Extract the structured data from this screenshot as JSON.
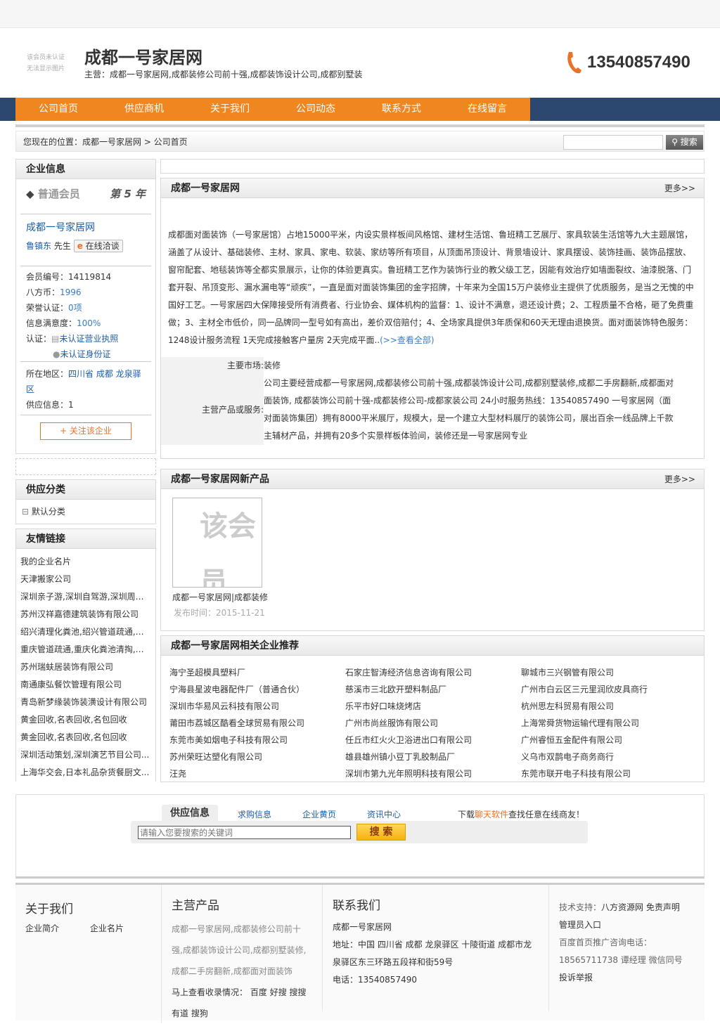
{
  "header": {
    "logo_placeholder": [
      "该会员未认证",
      "无法显示图片"
    ],
    "title": "成都一号家居网",
    "subtitle": "主营：成都一号家居网,成都装修公司前十强,成都装饰设计公司,成都别墅装",
    "phone": "13540857490"
  },
  "nav": [
    "公司首页",
    "供应商机",
    "关于我们",
    "公司动态",
    "联系方式",
    "在线留言"
  ],
  "breadcrumb": "您现在的位置：成都一号家居网 > 公司首页",
  "search_button": "搜索",
  "sidebar": {
    "info_title": "企业信息",
    "member_level": "普通会员",
    "member_years": "第 5 年",
    "company": "成都一号家居网",
    "contact_name": "鲁镇东",
    "contact_title": "先生",
    "chat": "在线洽谈",
    "member_id_label": "会员编号：",
    "member_id": "14119814",
    "coin_label": "八方币：",
    "coin": "1996",
    "honor_label": "荣誉认证：",
    "honor": "0项",
    "satisfaction_label": "信息满意度：",
    "satisfaction": "100%",
    "cert_label": "认证：",
    "cert_license": "未认证营业执照",
    "cert_id": "未认证身份证",
    "region_label": "所在地区：",
    "region": "四川省 成都 龙泉驿区",
    "supply_label": "供应信息：",
    "supply": "1",
    "follow": "+ 关注该企业",
    "category_title": "供应分类",
    "category": "默认分类",
    "links_title": "友情链接",
    "links": [
      "我的企业名片",
      "天津搬家公司",
      "深圳亲子游,深圳自驾游,深圳周边...",
      "苏州汉祥嘉德建筑装饰有限公司",
      "绍兴清理化粪池,绍兴管道疏通,绍...",
      "重庆管道疏通,重庆化粪池清掏,重...",
      "苏州瑞蚨居装饰有限公司",
      "南通康弘餐饮管理有限公司",
      "青岛新梦缘装饰装潢设计有限公司",
      "黄金回收,名表回收,名包回收",
      "黄金回收,名表回收,名包回收",
      "深圳活动策划,深圳演艺节目公司...",
      "上海华交会,日本礼品杂货餐厨文..."
    ]
  },
  "intro": {
    "title": "成都一号家居网",
    "more": "更多>>",
    "text": "成都面对面装饰（一号家居馆）占地15000平米，内设实景样板间风格馆、建材生活馆、鲁班精工艺展厅、家具软装生活馆等九大主题展馆，涵盖了从设计、基础装修、主材、家具、家电、软装、家纺等所有项目，从顶面吊顶设计、背景墙设计、家具摆设、装饰挂画、装饰品摆放、窗帘配套、地毯装饰等全都实景展示，让你的体验更真实。鲁班精工艺作为装饰行业的教父级工艺，因能有效治疗如墙面裂纹、油漆脱落、门套开裂、吊顶变形、漏水漏电等“顽疾”，一直是面对面装饰集团的金字招牌，十年来为全国15万户装修业主提供了优质服务，是当之无愧的中国好工艺。一号家居四大保障接受所有消费者、行业协会、媒体机构的监督：1、设计不满意，退还设计费；2、工程质量不合格，砸了免费重做；3、主材全市低价，同一品牌同一型号如有高出，差价双倍赔付；4、全场家具提供3年质保和60天无理由退换货。面对面装饰特色服务：1248设计服务流程 1天完成接触客户量房 2天完成平面..",
    "view_all": "(>>查看全部)",
    "market_label": "主要市场:",
    "market": "装修",
    "products_label": "主营产品或服务:",
    "products": "公司主要经营成都一号家居网,成都装修公司前十强,成都装饰设计公司,成都别墅装修,成都二手房翻新,成都面对面装饰, 成都装饰公司前十强-成都装修公司-成都家装公司 24小时服务热线：13540857490 一号家居网（面对面装饰集团）拥有8000平米展厅，规模大，是一个建立大型材料展厅的装饰公司，展出百余一线品牌上千款主辅材产品，并拥有20多个实景样板体验间，装修还是一号家居网专业"
  },
  "new_products": {
    "title": "成都一号家居网新产品",
    "more": "更多>>",
    "image_placeholder": "该会员 无法",
    "item_name": "成都一号家居网|成都装修",
    "item_date": "发布时间：2015-11-21"
  },
  "recommend": {
    "title": "成都一号家居网相关企业推荐",
    "items": [
      "海宁圣超模具塑料厂",
      "石家庄智涛经济信息咨询有限公司",
      "聊城市三兴钢管有限公司",
      "宁海县星波电器配件厂（普通合伙）",
      "慈溪市三北欧开塑料制品厂",
      "广州市白云区三元里润欣皮具商行",
      "深圳市华易风云科技有限公司",
      "乐平市好口味烧烤店",
      "杭州思左科贸易有限公司",
      "莆田市荔城区酷看全球贸易有限公司",
      "广州市尚丝服饰有限公司",
      "上海常舜货物运输代理有限公司",
      "东莞市美如烟电子科技有限公司",
      "任丘市红火火卫浴进出口有限公司",
      "广州睿恒五金配件有限公司",
      "苏州荣旺达塑化有限公司",
      "雄县雄州镇小豆丁乳胶制品厂",
      "义乌市双鹊电子商务商行",
      "汪尧",
      "深圳市第九光年照明科技有限公司",
      "东莞市联开电子科技有限公司"
    ]
  },
  "bottom_search": {
    "tabs": [
      "供应信息",
      "求购信息",
      "企业黄页",
      "资讯中心"
    ],
    "promo_pre": "下载",
    "promo_link": "聊天软件",
    "promo_post": "查找任意在线商友！",
    "placeholder": "请输入您要搜索的关键词",
    "button": "搜 索"
  },
  "footer": {
    "about_title": "关于我们",
    "about_links": [
      "企业简介",
      "企业名片"
    ],
    "products_title": "主营产品",
    "products_text": "成都一号家居网,成都装修公司前十强,成都装饰设计公司,成都别墅装修,成都二手房翻新,成都面对面装饰",
    "index_label": "马上查看收录情况：",
    "engines": [
      "百度",
      "好搜",
      "搜搜",
      "有道",
      "搜狗"
    ],
    "contact_title": "联系我们",
    "contact_company": "成都一号家居网",
    "address": "地址：中国 四川省 成都 龙泉驿区 十陵街道 成都市龙泉驿区东三环路五段祥和街59号",
    "tel": "电话：13540857490",
    "support_label": "技术支持：",
    "support": "八方资源网",
    "disclaimer": "免责声明",
    "admin": "管理员入口",
    "ad_label": "百度首页推广咨询电话：",
    "ad_phone": "18565711738 谭经理 微信同号",
    "report": "投诉举报"
  }
}
